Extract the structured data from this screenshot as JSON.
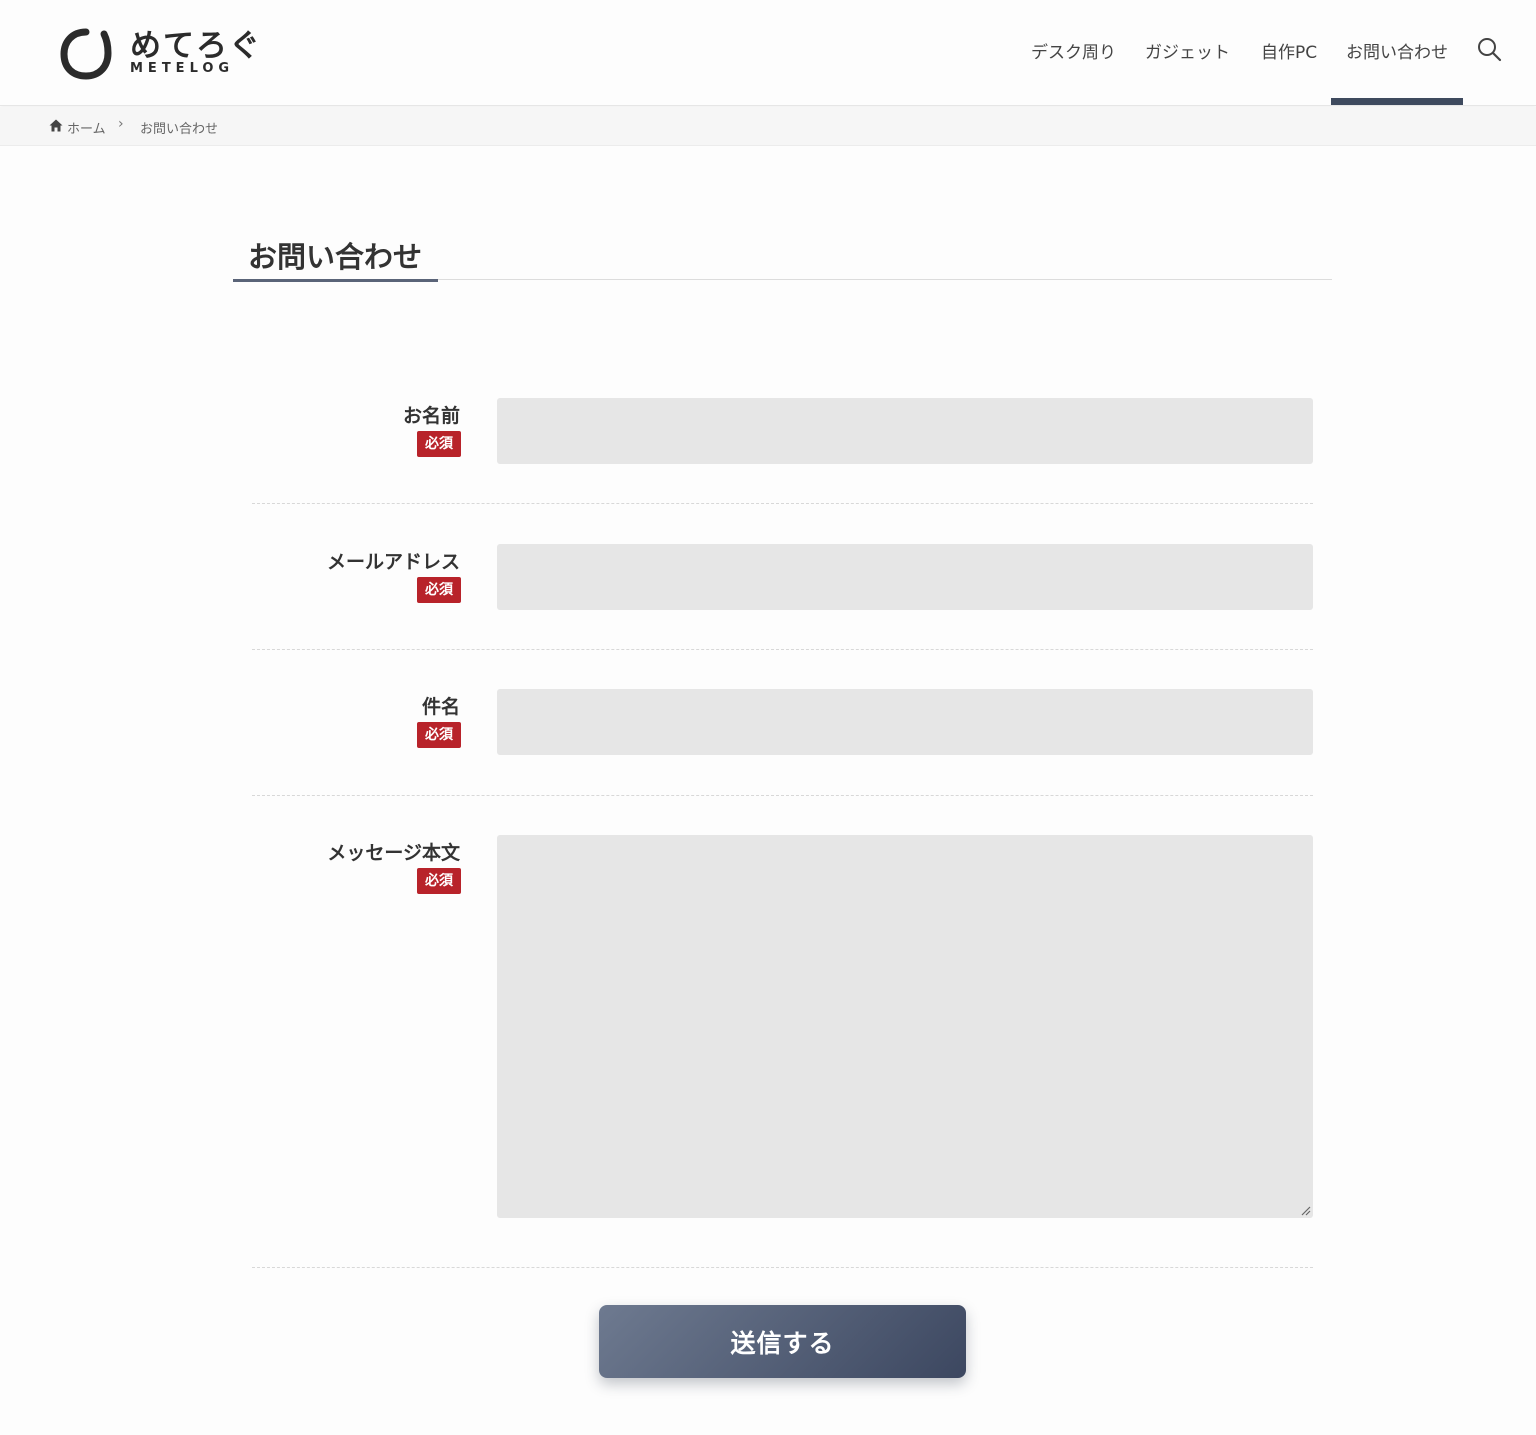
{
  "header": {
    "logo_text": "めてろぐ",
    "logo_sub": "METELOG",
    "nav": [
      {
        "label": "デスク周り"
      },
      {
        "label": "ガジェット"
      },
      {
        "label": "自作PC"
      },
      {
        "label": "お問い合わせ",
        "active": true
      }
    ]
  },
  "breadcrumb": {
    "home": "ホーム",
    "separator": "›",
    "current": "お問い合わせ"
  },
  "page": {
    "title": "お問い合わせ"
  },
  "form": {
    "required_label": "必須",
    "fields": [
      {
        "label": "お名前",
        "value": ""
      },
      {
        "label": "メールアドレス",
        "value": ""
      },
      {
        "label": "件名",
        "value": ""
      },
      {
        "label": "メッセージ本文",
        "value": ""
      }
    ],
    "submit_label": "送信する"
  },
  "colors": {
    "accent": "#3e4a5e",
    "required_badge": "#b8232a",
    "field_bg": "#e6e6e6"
  }
}
